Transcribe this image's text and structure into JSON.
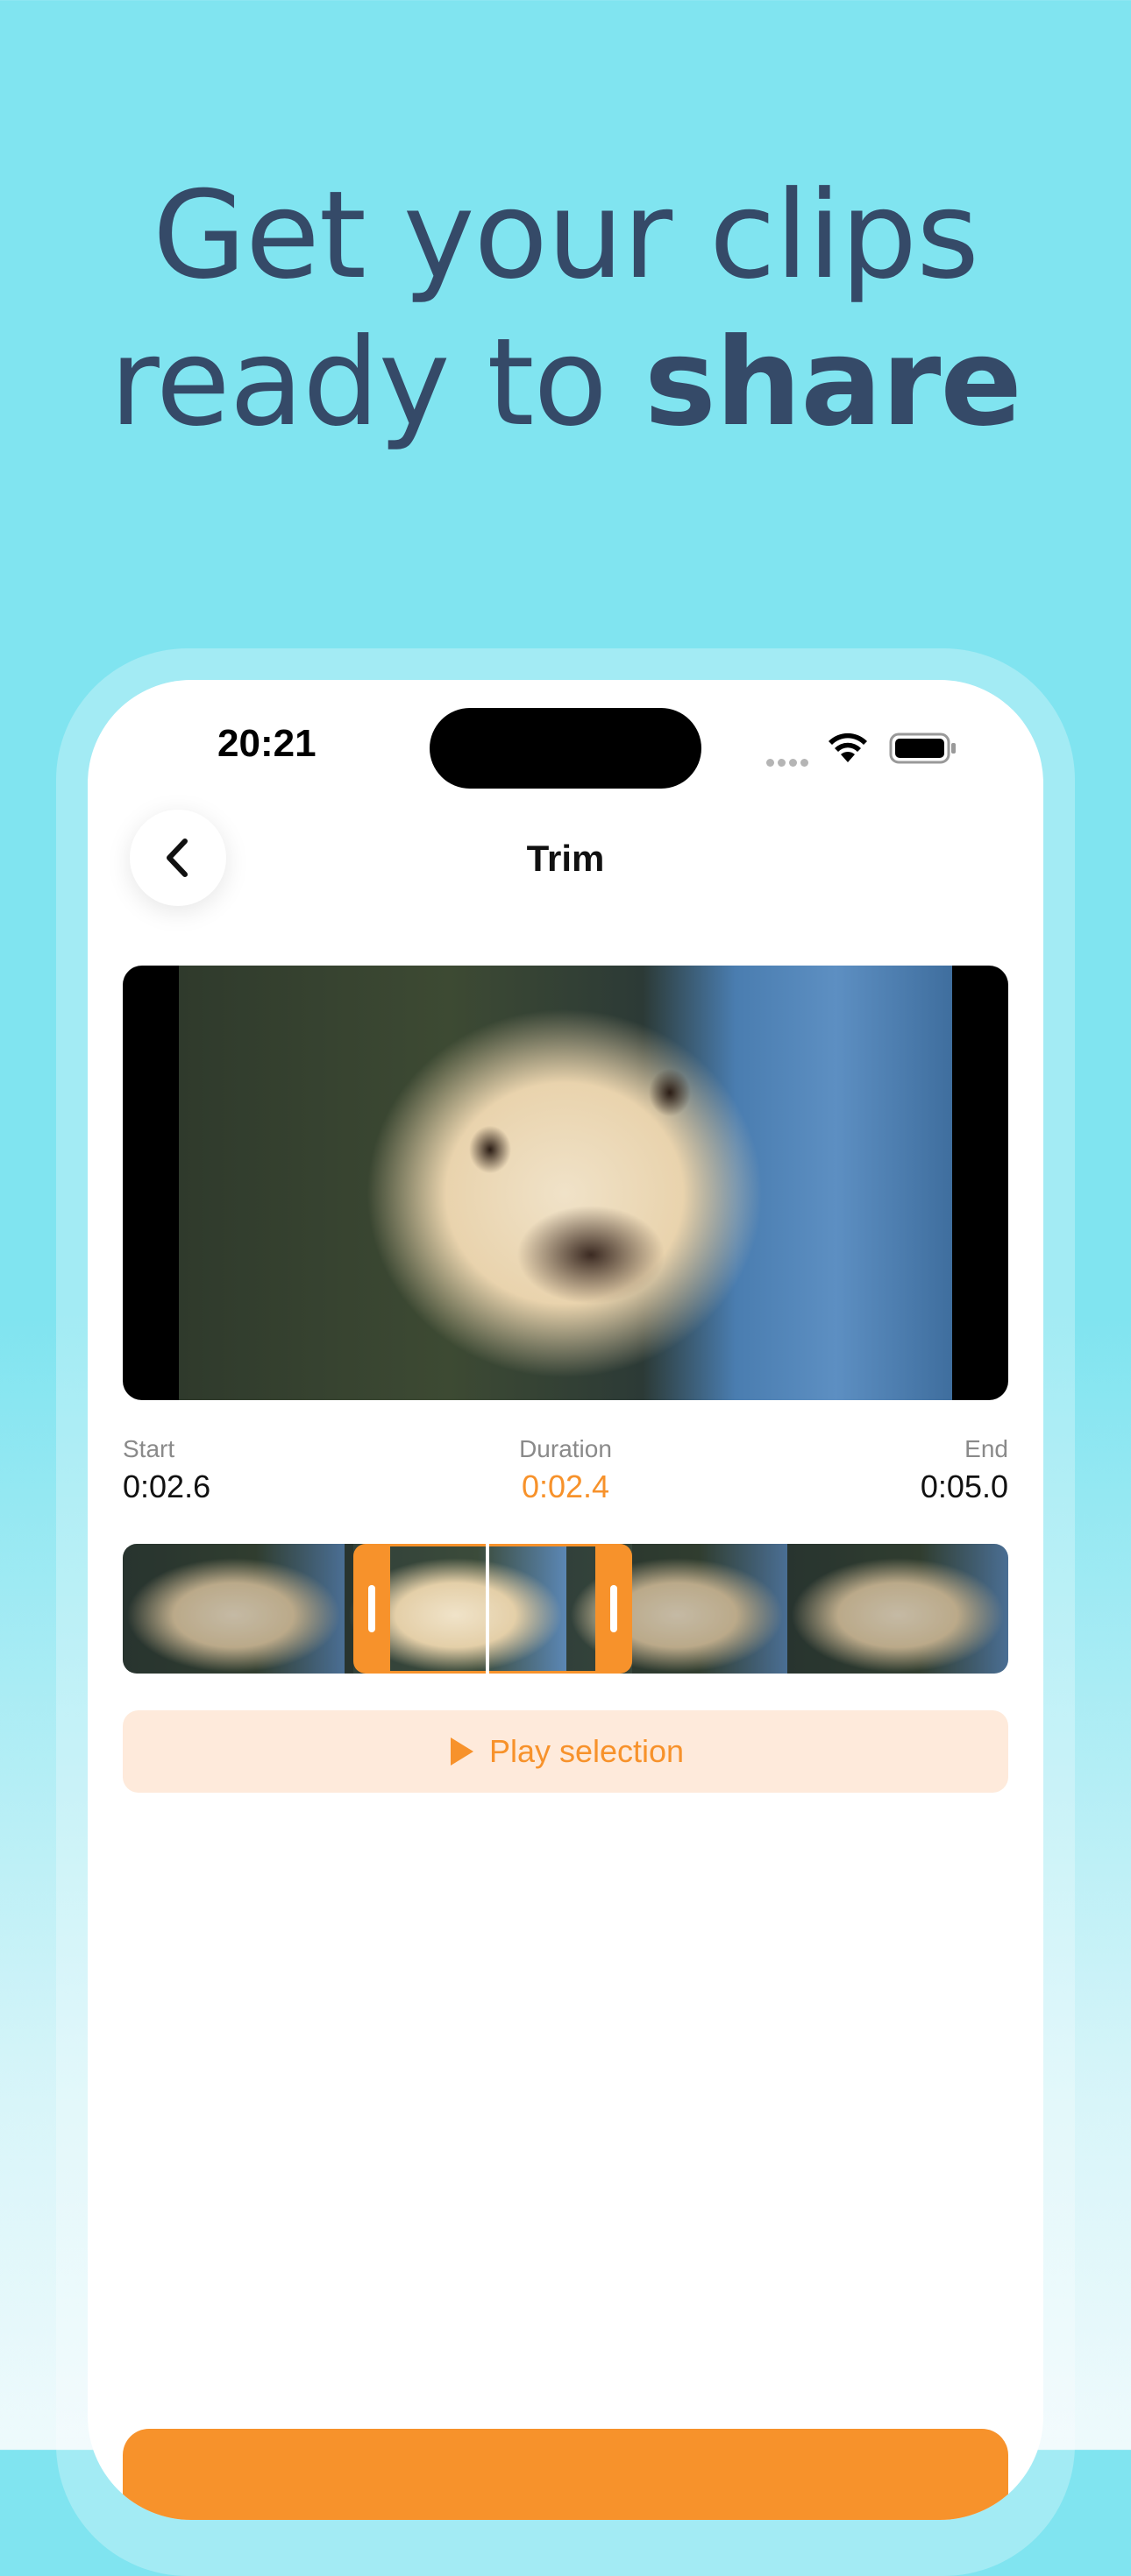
{
  "headline": {
    "line1": "Get your clips",
    "line2_regular": "ready to ",
    "line2_bold": "share"
  },
  "status_bar": {
    "time": "20:21"
  },
  "nav": {
    "title": "Trim"
  },
  "trim": {
    "start_label": "Start",
    "start_value": "0:02.6",
    "duration_label": "Duration",
    "duration_value": "0:02.4",
    "end_label": "End",
    "end_value": "0:05.0",
    "selection_start_fraction": 0.26,
    "selection_end_fraction": 0.575,
    "playhead_fraction": 0.41
  },
  "play_button": {
    "label": "Play selection"
  },
  "colors": {
    "accent": "#f7922b",
    "accent_light": "#feeadb",
    "headline": "#354a68",
    "background": "#80e4f0"
  }
}
